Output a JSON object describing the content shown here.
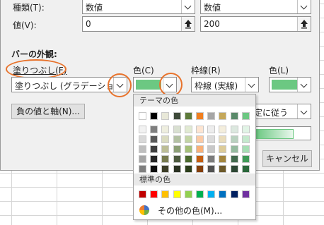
{
  "dialog": {
    "type_label": "種類(T):",
    "type_min_value": "数値",
    "type_max_value": "数値",
    "value_label": "値(V):",
    "value_min": "0",
    "value_max": "200",
    "bar_appearance_title": "バーの外観:",
    "fill_label": "塗りつぶし(F)",
    "color_label": "色(C)",
    "border_label": "枠線(R)",
    "border_color_label": "色(L)",
    "fill_value": "塗りつぶし (グラデーション)",
    "border_value": "枠線 (実線)",
    "negative_axis_button": "負の値と軸(N)...",
    "direction_partial": "定に従う",
    "cancel_button": "キャンセル",
    "bar_color": "#6cc882",
    "highlight_color": "#e8732c"
  },
  "color_popup": {
    "theme_header": "テーマの色",
    "standard_header": "標準の色",
    "more_colors": "その他の色(M)...",
    "theme_top_row": [
      "#ffffff",
      "#000000",
      "#e7e6e6",
      "#44546a",
      "#4472c4",
      "#ed7d31",
      "#a5a5a5",
      "#ffc000",
      "#5b9bd5",
      "#70ad47"
    ],
    "theme_columns": [
      [
        "#f2f2f2",
        "#d9d9d9",
        "#bfbfbf",
        "#a6a6a6",
        "#808080"
      ],
      [
        "#7f7f7f",
        "#595959",
        "#404040",
        "#262626",
        "#0d0d0d"
      ],
      [
        "#d0cece",
        "#aeabab",
        "#757171",
        "#3a3838",
        "#171616"
      ],
      [
        "#d6dce5",
        "#adb9ca",
        "#8497b0",
        "#333f50",
        "#222a35"
      ],
      [
        "#dae3f3",
        "#b4c7e7",
        "#8faadc",
        "#2f5597",
        "#203864"
      ],
      [
        "#fbe5d6",
        "#f8cbad",
        "#f4b183",
        "#c55a11",
        "#843c0c"
      ],
      [
        "#ededed",
        "#dbdbdb",
        "#c9c9c9",
        "#7b7b7b",
        "#525252"
      ],
      [
        "#fff2cc",
        "#ffe699",
        "#ffd966",
        "#bf9000",
        "#7f6000"
      ],
      [
        "#deebf7",
        "#bdd7ee",
        "#9dc3e6",
        "#2e75b6",
        "#1f4e79"
      ],
      [
        "#e2f0d9",
        "#c5e0b4",
        "#a9d18e",
        "#548235",
        "#385723"
      ]
    ],
    "theme_top_row_shown": [
      "#ffffff",
      "#000000",
      "#e8e8d8",
      "#3e4a3a",
      "#5d7a3a",
      "#f07f20",
      "#a6a6a6",
      "#c5a85a",
      "#5a8a6a",
      "#6cc882"
    ],
    "theme_columns_shown": [
      [
        "#f2f2f2",
        "#d9d9d9",
        "#bfbfbf",
        "#a6a6a6",
        "#7f7f7f"
      ],
      [
        "#7f7f7f",
        "#595959",
        "#3f3f3f",
        "#262626",
        "#0c0c0c"
      ],
      [
        "#eeeedf",
        "#dadbc0",
        "#bcbd96",
        "#777a4e",
        "#3c3d27"
      ],
      [
        "#d9e0d1",
        "#b3c1a3",
        "#8c9f76",
        "#4d5a3f",
        "#2a3122"
      ],
      [
        "#e1ead2",
        "#c3d5a5",
        "#a5c078",
        "#4b6a2d",
        "#2b3d1a"
      ],
      [
        "#fde5d2",
        "#fbcaa5",
        "#f8b078",
        "#c45e10",
        "#843f0b"
      ],
      [
        "#ededed",
        "#dbdbdb",
        "#c8c8c8",
        "#7c7c7c",
        "#525252"
      ],
      [
        "#f4eedd",
        "#e9dcbb",
        "#dccb99",
        "#a3863f",
        "#6c592a"
      ],
      [
        "#dce8df",
        "#b9d1bf",
        "#95ba9f",
        "#436a4e",
        "#2d4734"
      ],
      [
        "#e1f4e6",
        "#c4e9cd",
        "#a6deb4",
        "#3f9a57",
        "#2a673a"
      ]
    ],
    "standard_colors": [
      "#c00000",
      "#ff0000",
      "#ffc000",
      "#ffff00",
      "#92d050",
      "#00b050",
      "#00b0f0",
      "#0070c0",
      "#002060",
      "#7030a0"
    ]
  }
}
